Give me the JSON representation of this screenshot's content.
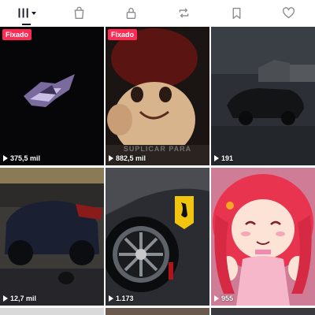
{
  "tabs": [
    {
      "icon": "grid-icon",
      "active": true
    },
    {
      "icon": "shopping-bag-icon",
      "active": false
    },
    {
      "icon": "lock-icon",
      "active": false
    },
    {
      "icon": "repost-icon",
      "active": false
    },
    {
      "icon": "bookmark-icon",
      "active": false
    },
    {
      "icon": "heart-icon",
      "active": false
    }
  ],
  "videos": [
    {
      "pinned": "Fixado",
      "views": "375,5 mil"
    },
    {
      "pinned": "Fixado",
      "views": "882,5 mil",
      "watermark": "SUPLICAR PARA"
    },
    {
      "views": "191"
    },
    {
      "views": "12,7 mil"
    },
    {
      "views": "1.173"
    },
    {
      "views": "955"
    }
  ],
  "colors": {
    "accent": "#fe2c55",
    "text": "#161823"
  }
}
